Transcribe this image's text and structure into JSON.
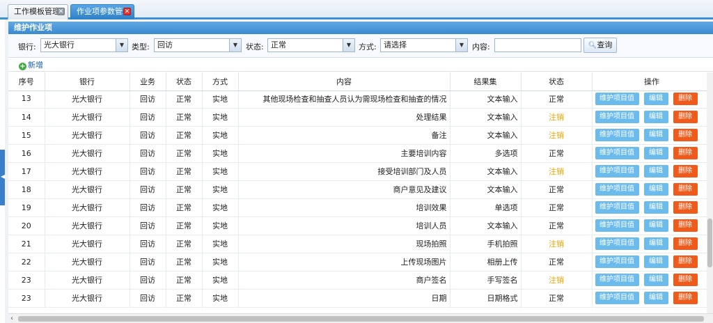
{
  "tabs": [
    {
      "label": "工作模板管理",
      "active": false
    },
    {
      "label": "作业项参数管理",
      "active": true
    }
  ],
  "panel": {
    "title": "维护作业项"
  },
  "filters": {
    "bank_label": "银行:",
    "bank_value": "光大银行",
    "type_label": "类型:",
    "type_value": "回访",
    "status_label": "状态:",
    "status_value": "正常",
    "method_label": "方式:",
    "method_value": "请选择",
    "content_label": "内容:",
    "content_value": "",
    "query_label": "查询"
  },
  "toolbar": {
    "add_label": "新增"
  },
  "table": {
    "headers": [
      "序号",
      "银行",
      "业务",
      "状态",
      "方式",
      "内容",
      "结果集",
      "状态",
      "操作"
    ],
    "rows": [
      {
        "no": "13",
        "bank": "光大银行",
        "biz": "回访",
        "status": "正常",
        "method": "实地",
        "content": "其他现场检查和抽查人员认为需现场检查和抽查的情况",
        "result": "文本输入",
        "state": "正常"
      },
      {
        "no": "14",
        "bank": "光大银行",
        "biz": "回访",
        "status": "正常",
        "method": "实地",
        "content": "处理结果",
        "result": "文本输入",
        "state": "注销"
      },
      {
        "no": "15",
        "bank": "光大银行",
        "biz": "回访",
        "status": "正常",
        "method": "实地",
        "content": "备注",
        "result": "文本输入",
        "state": "注销"
      },
      {
        "no": "16",
        "bank": "光大银行",
        "biz": "回访",
        "status": "正常",
        "method": "实地",
        "content": "主要培训内容",
        "result": "多选项",
        "state": "正常"
      },
      {
        "no": "17",
        "bank": "光大银行",
        "biz": "回访",
        "status": "正常",
        "method": "实地",
        "content": "接受培训部门及人员",
        "result": "文本输入",
        "state": "注销"
      },
      {
        "no": "18",
        "bank": "光大银行",
        "biz": "回访",
        "status": "正常",
        "method": "实地",
        "content": "商户意见及建议",
        "result": "文本输入",
        "state": "正常"
      },
      {
        "no": "19",
        "bank": "光大银行",
        "biz": "回访",
        "status": "正常",
        "method": "实地",
        "content": "培训效果",
        "result": "单选项",
        "state": "正常"
      },
      {
        "no": "20",
        "bank": "光大银行",
        "biz": "回访",
        "status": "正常",
        "method": "实地",
        "content": "培训人员",
        "result": "文本输入",
        "state": "正常"
      },
      {
        "no": "21",
        "bank": "光大银行",
        "biz": "回访",
        "status": "正常",
        "method": "实地",
        "content": "现场拍照",
        "result": "手机拍照",
        "state": "注销"
      },
      {
        "no": "22",
        "bank": "光大银行",
        "biz": "回访",
        "status": "正常",
        "method": "实地",
        "content": "上传现场图片",
        "result": "相册上传",
        "state": "正常"
      },
      {
        "no": "23",
        "bank": "光大银行",
        "biz": "回访",
        "status": "正常",
        "method": "实地",
        "content": "商户签名",
        "result": "手写签名",
        "state": "注销"
      },
      {
        "no": "23",
        "bank": "光大银行",
        "biz": "回访",
        "status": "正常",
        "method": "实地",
        "content": "日期",
        "result": "日期格式",
        "state": "正常"
      }
    ],
    "actions": {
      "item_value": "维护项目值",
      "edit": "编辑",
      "delete": "删除"
    }
  },
  "colors": {
    "accent": "#3b8fd6",
    "cancel_state": "#f0a500",
    "delete_button": "#f05a1a",
    "action_button": "#6bbcec"
  }
}
